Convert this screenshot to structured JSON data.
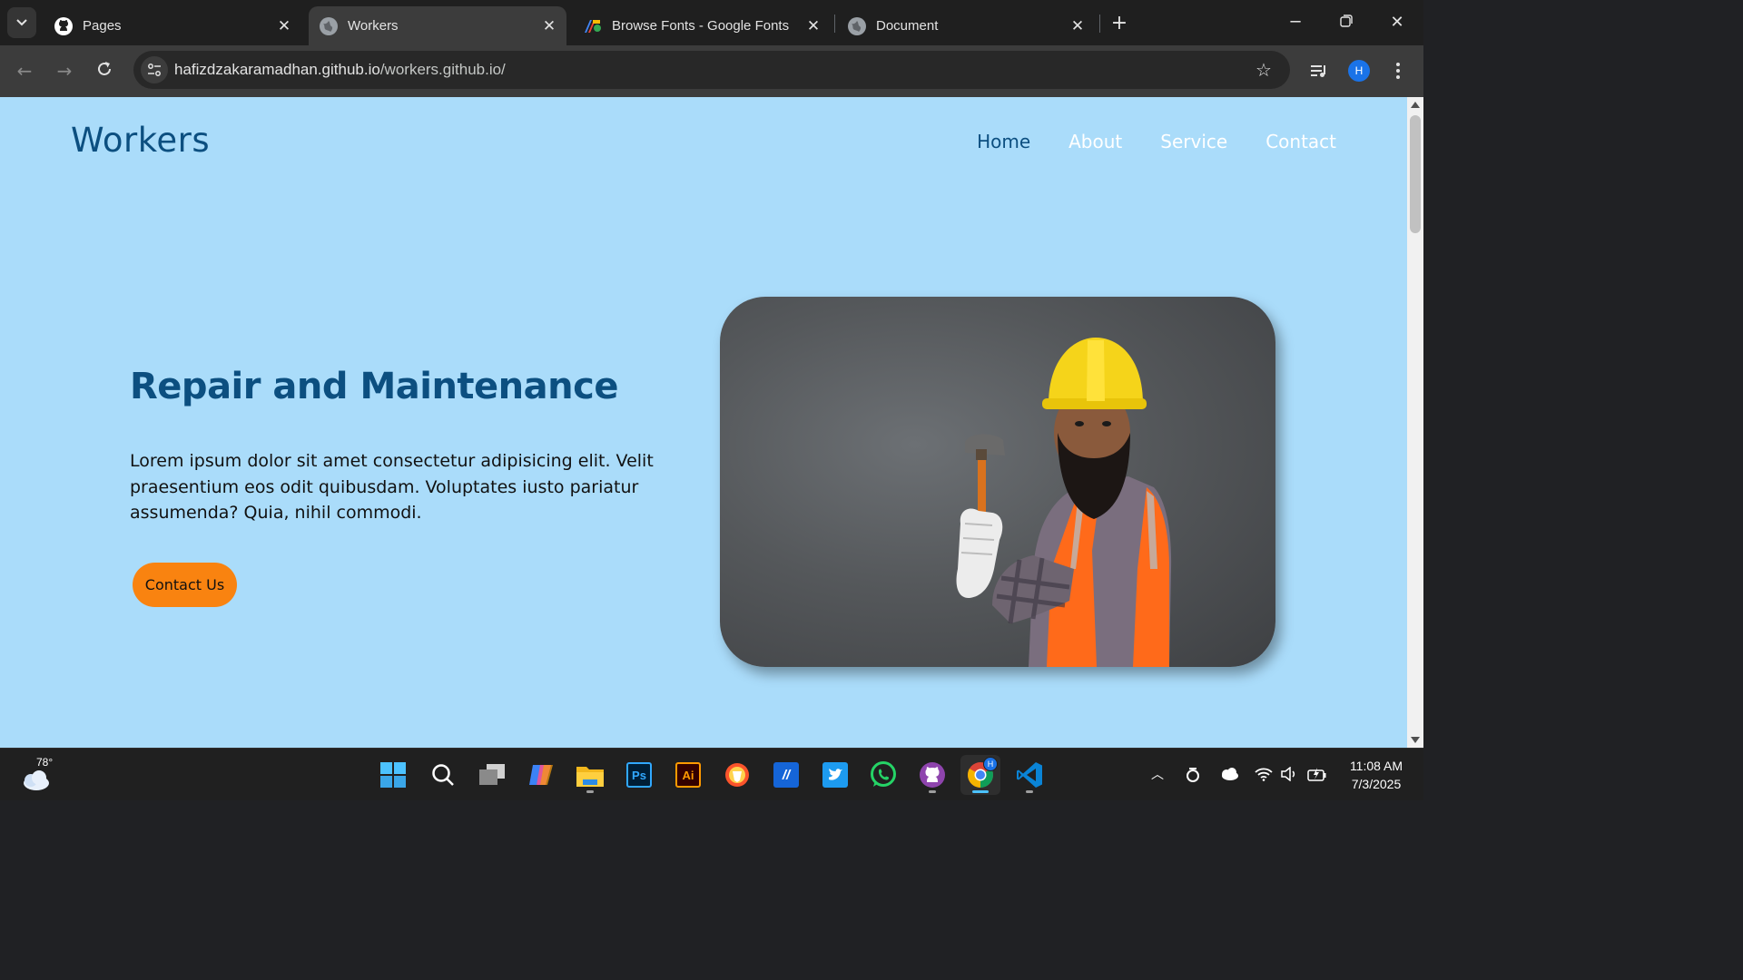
{
  "browser": {
    "tabs": [
      {
        "title": "Pages",
        "favicon": "github-icon",
        "active": false
      },
      {
        "title": "Workers",
        "favicon": "globe-icon",
        "active": true
      },
      {
        "title": "Browse Fonts - Google Fonts",
        "favicon": "google-fonts-icon",
        "active": false
      },
      {
        "title": "Document",
        "favicon": "globe-icon",
        "active": false
      }
    ],
    "url_host": "hafizdzakaramadhan.github.io",
    "url_path": "/workers.github.io/",
    "profile_initial": "H"
  },
  "page": {
    "logo": "Workers",
    "nav": [
      {
        "label": "Home",
        "current": true
      },
      {
        "label": "About",
        "current": false
      },
      {
        "label": "Service",
        "current": false
      },
      {
        "label": "Contact",
        "current": false
      }
    ],
    "hero": {
      "title": "Repair and Maintenance",
      "description": "Lorem ipsum dolor sit amet consectetur adipisicing elit. Velit praesentium eos odit quibusdam. Voluptates iusto pariatur assumenda? Quia, nihil commodi.",
      "cta_label": "Contact Us",
      "image": "construction-worker-with-hammer-photo"
    },
    "colors": {
      "background": "#aadcfa",
      "brand": "#0c4f80",
      "cta": "#f98310",
      "nav_inactive": "#ffffff"
    }
  },
  "taskbar": {
    "weather_temp": "78°",
    "apps": [
      "windows-start-icon",
      "search-icon",
      "task-view-icon",
      "copilot-icon",
      "file-explorer-icon",
      "photoshop-icon",
      "illustrator-icon",
      "brave-icon",
      "app-icon",
      "twitter-icon",
      "whatsapp-icon",
      "github-desktop-icon",
      "chrome-icon",
      "vscode-icon"
    ],
    "clock_time": "11:08 AM",
    "clock_date": "7/3/2025"
  }
}
